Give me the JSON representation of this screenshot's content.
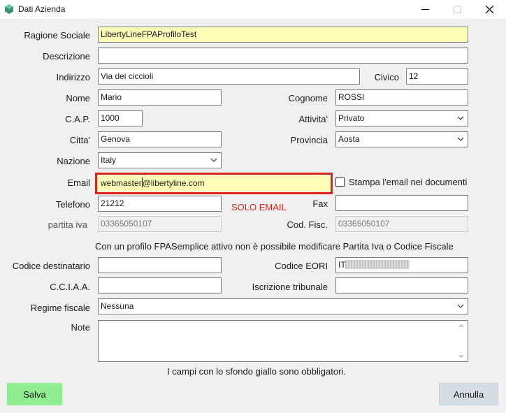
{
  "window": {
    "title": "Dati Azienda",
    "icon": "app-logo-icon"
  },
  "form": {
    "ragione_sociale": {
      "label": "Ragione Sociale",
      "value": "LibertyLineFPAProfiloTest"
    },
    "descrizione": {
      "label": "Descrizione",
      "value": ""
    },
    "indirizzo": {
      "label": "Indirizzo",
      "value": "Via dei ciccioli"
    },
    "civico": {
      "label": "Civico",
      "value": "12"
    },
    "nome": {
      "label": "Nome",
      "value": "Mario"
    },
    "cognome": {
      "label": "Cognome",
      "value": "ROSSI"
    },
    "cap": {
      "label": "C.A.P.",
      "value": "1000"
    },
    "attivita": {
      "label": "Attivita'",
      "value": "Privato"
    },
    "citta": {
      "label": "Citta'",
      "value": "Genova"
    },
    "provincia": {
      "label": "Provincia",
      "value": "Aosta"
    },
    "nazione": {
      "label": "Nazione",
      "value": "Italy"
    },
    "email": {
      "label": "Email",
      "value_before_caret": "webmaster",
      "value_after_caret": "@libertyline.com"
    },
    "stampa_email": {
      "label": "Stampa l'email nei documenti",
      "checked": false
    },
    "annotation": "SOLO EMAIL",
    "telefono": {
      "label": "Telefono",
      "value": "21212"
    },
    "fax": {
      "label": "Fax",
      "value": ""
    },
    "partita_iva": {
      "label": "partita iva",
      "value": "03365050107"
    },
    "cod_fisc": {
      "label": "Cod. Fisc.",
      "value": "03365050107"
    },
    "info": "Con un profilo FPASemplice attivo non è possibile modificare Partita Iva o Codice Fiscale",
    "codice_destinatario": {
      "label": "Codice destinatario",
      "value": ""
    },
    "codice_eori": {
      "label": "Codice EORI",
      "value": "IT"
    },
    "cciaa": {
      "label": "C.C.I.A.A.",
      "value": ""
    },
    "iscrizione_tribunale": {
      "label": "Iscrizione tribunale",
      "value": ""
    },
    "regime_fiscale": {
      "label": "Regime fiscale",
      "value": "Nessuna"
    },
    "note": {
      "label": "Note",
      "value": ""
    },
    "footer_note": "I campi con lo sfondo giallo sono obbligatori."
  },
  "buttons": {
    "save": "Salva",
    "cancel": "Annulla"
  },
  "colors": {
    "required_bg": "#fefeb8",
    "highlight": "#d9261c",
    "save_bg": "#90ee90",
    "cancel_bg": "#d6dde3"
  }
}
